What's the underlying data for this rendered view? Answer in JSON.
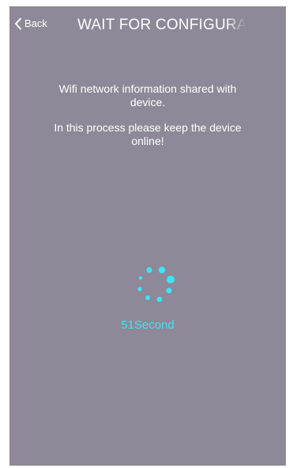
{
  "header": {
    "back_label": "Back",
    "title": "WAIT FOR CONFIGURATION"
  },
  "main": {
    "message_line1": "Wifi network information shared with device.",
    "message_line2": "In this process please keep the device online!",
    "countdown": "51Second"
  },
  "icons": {
    "back": "chevron-left-icon",
    "spinner": "loading-spinner-icon"
  },
  "colors": {
    "background": "#8e8898",
    "accent": "#3fe4f2",
    "text": "#ffffff"
  }
}
